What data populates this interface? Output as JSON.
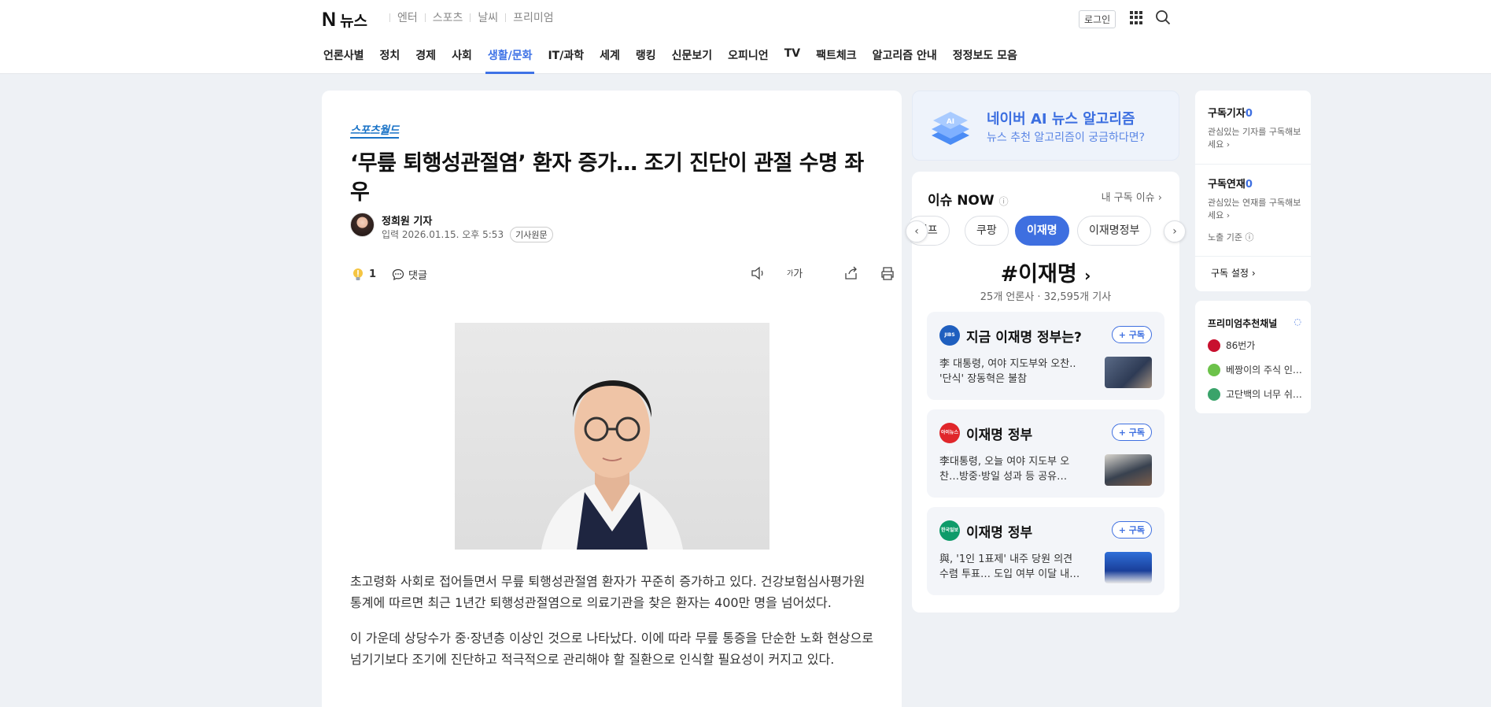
{
  "header": {
    "logo_mark": "N",
    "logo_text": "뉴스",
    "services": [
      "엔터",
      "스포츠",
      "날씨",
      "프리미엄"
    ],
    "login": "로그인",
    "nav": [
      {
        "label": "언론사별",
        "active": false
      },
      {
        "label": "정치",
        "active": false
      },
      {
        "label": "경제",
        "active": false
      },
      {
        "label": "사회",
        "active": false
      },
      {
        "label": "생활/문화",
        "active": true
      },
      {
        "label": "IT/과학",
        "active": false
      },
      {
        "label": "세계",
        "active": false
      },
      {
        "label": "랭킹",
        "active": false
      },
      {
        "label": "신문보기",
        "active": false
      },
      {
        "label": "오피니언",
        "active": false
      },
      {
        "label": "TV",
        "active": false
      },
      {
        "label": "팩트체크",
        "active": false
      },
      {
        "label": "알고리즘 안내",
        "active": false
      },
      {
        "label": "정정보도 모음",
        "active": false
      }
    ],
    "accent": "#3e72e6"
  },
  "article": {
    "press": "스포츠월드",
    "title": "‘무릎 퇴행성관절염’ 환자 증가… 조기 진단이 관절 수명 좌우",
    "reporter": "정희원 기자",
    "date": "입력 2026.01.15. 오후 5:53",
    "original_label": "기사원문",
    "reaction_count": "1",
    "comment_label": "댓글",
    "font_size_label": "가",
    "paragraphs": [
      "초고령화 사회로 접어들면서 무릎 퇴행성관절염 환자가 꾸준히 증가하고 있다. 건강보험심사평가원 통계에 따르면 최근 1년간 퇴행성관절염으로 의료기관을 찾은 환자는 400만 명을 넘어섰다.",
      "이 가운데 상당수가 중·장년층 이상인 것으로 나타났다. 이에 따라 무릎 통증을 단순한 노화 현상으로 넘기기보다 조기에 진단하고 적극적으로 관리해야 할 질환으로 인식할 필요성이 커지고 있다."
    ]
  },
  "ai_banner": {
    "title": "네이버 AI 뉴스 알고리즘",
    "subtitle": "뉴스 추천 알고리즘이 궁금하다면?"
  },
  "issue_now": {
    "heading": "이슈 NOW",
    "my_issue": "내 구독 이슈",
    "chips": [
      "럼프",
      "쿠팡",
      "이재명",
      "이재명정부"
    ],
    "active_chip": "이재명",
    "tag": "#이재명",
    "stats": "25개 언론사 · 32,595개 기사",
    "subscribe_label": "+ 구독",
    "cards": [
      {
        "press_logo": "JIBS",
        "title": "지금 이재명 정부는?",
        "text": "李 대통령, 여야 지도부와 오찬.. '단식' 장동혁은 불참",
        "logo_color": "#1f5fbf"
      },
      {
        "press_logo": "아이뉴스24",
        "title": "이재명 정부",
        "text": "李대통령, 오늘 여야 지도부 오찬…방중·방일 성과 등 공유…",
        "logo_color": "#e0262b"
      },
      {
        "press_logo": "한국일보",
        "title": "이재명 정부",
        "text": "與, '1인 1표제' 내주 당원 의견수렴 투표… 도입 여부 이달 내…",
        "logo_color": "#0f9b6a"
      }
    ]
  },
  "sidebar": {
    "reporter_sub": {
      "label": "구독기자",
      "count": "0",
      "desc": "관심있는 기자를 구독해보세요"
    },
    "series_sub": {
      "label": "구독연재",
      "count": "0",
      "desc": "관심있는 연재를 구독해보세요"
    },
    "criteria": "노출 기준",
    "settings": "구독 설정",
    "premium_heading": "프리미엄추천채널",
    "premium": [
      {
        "name": "86번가",
        "color": "#c8102e"
      },
      {
        "name": "베짱이의 주식 인…",
        "color": "#6cc24a"
      },
      {
        "name": "고단백의 너무 쉬…",
        "color": "#3aa36a"
      }
    ]
  }
}
